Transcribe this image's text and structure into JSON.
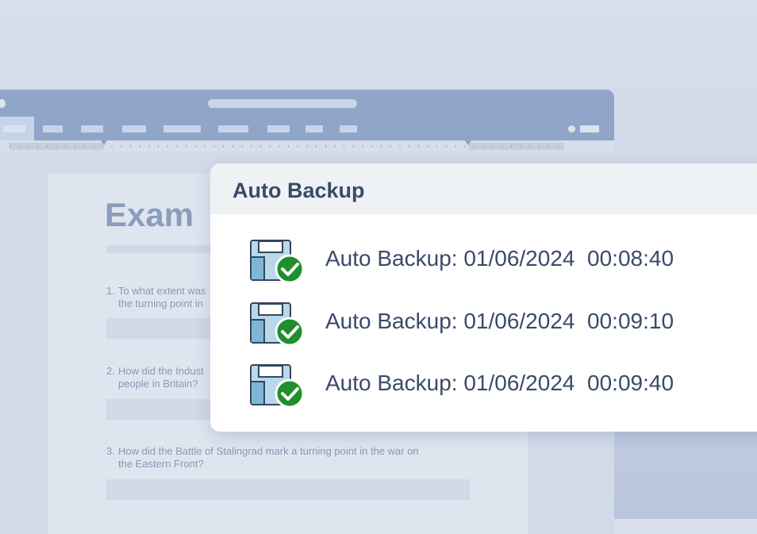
{
  "document": {
    "title": "Exam",
    "questions": [
      {
        "num": "1.",
        "text": "To what extent was\nthe turning point in"
      },
      {
        "num": "2.",
        "text": "How did the Indust\npeople in Britain?"
      },
      {
        "num": "3.",
        "text": "How did the Battle of Stalingrad mark a turning point in the war on\nthe Eastern Front?"
      }
    ]
  },
  "dialog": {
    "title": "Auto Backup",
    "entries": [
      {
        "label": "Auto Backup: 01/06/2024  00:08:40",
        "icon": "backup-file-check-icon"
      },
      {
        "label": "Auto Backup: 01/06/2024  00:09:10",
        "icon": "backup-file-check-icon"
      },
      {
        "label": "Auto Backup: 01/06/2024  00:09:40",
        "icon": "backup-file-check-icon"
      }
    ]
  },
  "colors": {
    "accent": "#8fa6c9",
    "check": "#1e8f2a",
    "text": "#3a4a68"
  }
}
